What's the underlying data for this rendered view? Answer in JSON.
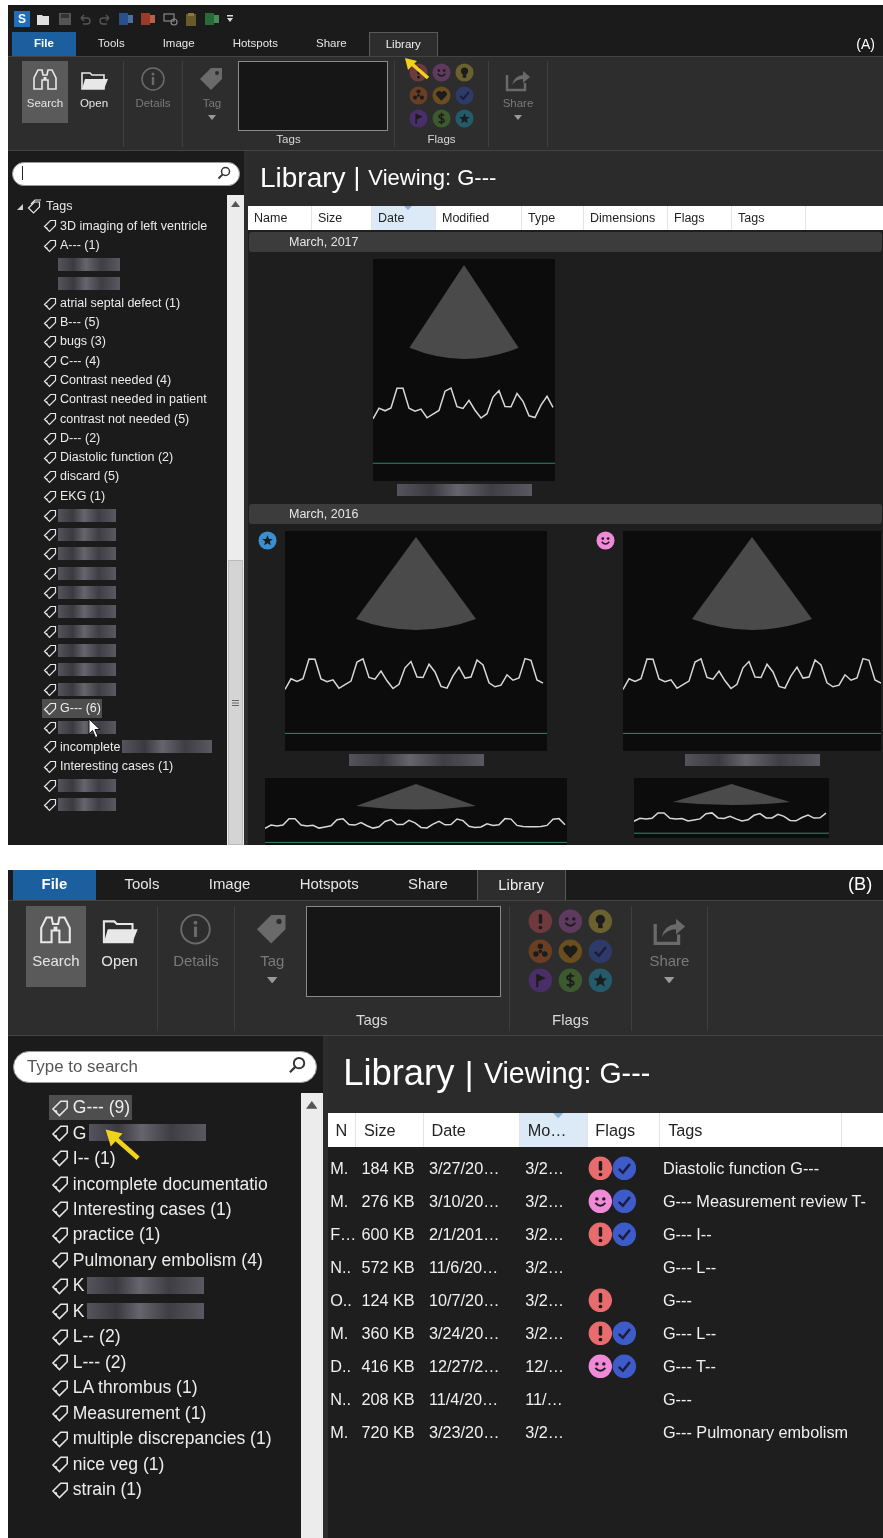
{
  "panels": [
    {
      "label": "(A)",
      "logo": "S",
      "tabs": [
        {
          "label": "File",
          "kind": "file",
          "selected": false
        },
        {
          "label": "Tools",
          "kind": "tab",
          "selected": false
        },
        {
          "label": "Image",
          "kind": "tab",
          "selected": false
        },
        {
          "label": "Hotspots",
          "kind": "tab",
          "selected": false
        },
        {
          "label": "Share",
          "kind": "tab",
          "selected": false
        },
        {
          "label": "Library",
          "kind": "tab",
          "selected": true
        }
      ],
      "ribbon": [
        {
          "kind": "buttons",
          "buttons": [
            {
              "label": "Search",
              "kind": "search",
              "selected": true,
              "disabled": false
            },
            {
              "label": "Open",
              "kind": "open",
              "selected": false,
              "disabled": false
            }
          ]
        },
        {
          "kind": "buttons",
          "buttons": [
            {
              "label": "Details",
              "kind": "details",
              "selected": false,
              "disabled": true
            }
          ]
        },
        {
          "kind": "tag_box",
          "label": "Tags",
          "buttons": [
            {
              "label": "Tag",
              "kind": "tag",
              "selected": false,
              "disabled": true
            }
          ]
        },
        {
          "kind": "flags",
          "label": "Flags",
          "flags": [
            {
              "kind": "alert",
              "color": "#6e3a3e"
            },
            {
              "kind": "smile",
              "color": "#5e3a5e"
            },
            {
              "kind": "bulb",
              "color": "#6a6030"
            },
            {
              "kind": "radiation",
              "color": "#6a3e22"
            },
            {
              "kind": "heart",
              "color": "#6a4e20"
            },
            {
              "kind": "check",
              "color": "#2e3a68"
            },
            {
              "kind": "flag",
              "color": "#4a2e6a"
            },
            {
              "kind": "dollar",
              "color": "#3c5a2e"
            },
            {
              "kind": "star",
              "color": "#245a6a"
            }
          ]
        },
        {
          "kind": "buttons",
          "buttons": [
            {
              "label": "Share",
              "kind": "share",
              "selected": false,
              "disabled": true
            }
          ]
        }
      ],
      "search": {
        "focused": true
      },
      "tree": {
        "root": {
          "label": "Tags",
          "expanded": true
        },
        "items": [
          {
            "kind": "tag",
            "label": "3D imaging of left ventricle",
            "redacted": false,
            "selected": false
          },
          {
            "kind": "tag",
            "label": "A--- (1)",
            "redacted": false,
            "selected": false
          },
          {
            "kind": "blurred",
            "redacted": true,
            "selected": false
          },
          {
            "kind": "blurred",
            "redacted": true,
            "selected": false
          },
          {
            "kind": "tag",
            "label": "atrial septal defect (1)",
            "redacted": false,
            "selected": false
          },
          {
            "kind": "tag",
            "label": "B--- (5)",
            "redacted": false,
            "selected": false
          },
          {
            "kind": "tag",
            "label": "bugs (3)",
            "redacted": false,
            "selected": false
          },
          {
            "kind": "tag",
            "label": "C--- (4)",
            "redacted": false,
            "selected": false
          },
          {
            "kind": "tag",
            "label": "Contrast needed (4)",
            "redacted": false,
            "selected": false
          },
          {
            "kind": "tag",
            "label": "Contrast needed in patient",
            "redacted": false,
            "selected": false
          },
          {
            "kind": "tag",
            "label": "contrast not needed (5)",
            "redacted": false,
            "selected": false
          },
          {
            "kind": "tag",
            "label": "D--- (2)",
            "redacted": false,
            "selected": false
          },
          {
            "kind": "tag",
            "label": "Diastolic function (2)",
            "redacted": false,
            "selected": false
          },
          {
            "kind": "tag",
            "label": "discard (5)",
            "redacted": false,
            "selected": false
          },
          {
            "kind": "tag",
            "label": "EKG (1)",
            "redacted": false,
            "selected": false
          },
          {
            "kind": "tag",
            "redacted": true,
            "selected": false
          },
          {
            "kind": "tag",
            "redacted": true,
            "selected": false
          },
          {
            "kind": "tag",
            "redacted": true,
            "selected": false
          },
          {
            "kind": "tag",
            "redacted": true,
            "selected": false
          },
          {
            "kind": "tag",
            "redacted": true,
            "selected": false
          },
          {
            "kind": "tag",
            "redacted": true,
            "selected": false
          },
          {
            "kind": "tag",
            "redacted": true,
            "selected": false
          },
          {
            "kind": "tag",
            "redacted": true,
            "selected": false
          },
          {
            "kind": "tag",
            "redacted": true,
            "selected": false
          },
          {
            "kind": "tag",
            "redacted": true,
            "selected": false
          },
          {
            "kind": "tag",
            "label": "G--- (6)",
            "redacted": false,
            "selected": true
          },
          {
            "kind": "tag",
            "redacted": true,
            "selected": false
          },
          {
            "kind": "tag",
            "label": "incomplete",
            "redacted": true,
            "selected": false
          },
          {
            "kind": "tag",
            "label": "Interesting cases (1)",
            "redacted": false,
            "selected": false
          },
          {
            "kind": "tag",
            "redacted": true,
            "selected": false
          },
          {
            "kind": "tag",
            "redacted": true,
            "selected": false
          }
        ]
      },
      "view": {
        "title": "Library",
        "separator": "|",
        "subtitle": "Viewing: G---",
        "columns": [
          {
            "label": "Name",
            "selected": false
          },
          {
            "label": "Size",
            "selected": false
          },
          {
            "label": "Date",
            "selected": true
          },
          {
            "label": "Modified",
            "selected": false
          },
          {
            "label": "Type",
            "selected": false
          },
          {
            "label": "Dimensions",
            "selected": false
          },
          {
            "label": "Flags",
            "selected": false
          },
          {
            "label": "Tags",
            "selected": false
          }
        ],
        "groups": [
          {
            "label": "March, 2017",
            "items": [
              {
                "kind": "none",
                "caption_redacted": true
              }
            ]
          },
          {
            "label": "March, 2016",
            "items": [
              {
                "kind": "star",
                "caption_redacted": true
              },
              {
                "kind": "smile",
                "caption_redacted": true
              },
              {
                "kind": "none",
                "caption_redacted": false
              },
              {
                "kind": "none",
                "caption_redacted": false
              }
            ]
          }
        ]
      }
    },
    {
      "label": "(B)",
      "tabs": [
        {
          "label": "File",
          "kind": "file",
          "selected": false
        },
        {
          "label": "Tools",
          "kind": "tab",
          "selected": false
        },
        {
          "label": "Image",
          "kind": "tab",
          "selected": false
        },
        {
          "label": "Hotspots",
          "kind": "tab",
          "selected": false
        },
        {
          "label": "Share",
          "kind": "tab",
          "selected": false
        },
        {
          "label": "Library",
          "kind": "tab",
          "selected": true
        }
      ],
      "ribbon": [
        {
          "kind": "buttons",
          "buttons": [
            {
              "label": "Search",
              "kind": "search",
              "selected": true,
              "disabled": false
            },
            {
              "label": "Open",
              "kind": "open",
              "selected": false,
              "disabled": false
            }
          ]
        },
        {
          "kind": "buttons",
          "buttons": [
            {
              "label": "Details",
              "kind": "details",
              "selected": false,
              "disabled": true
            }
          ]
        },
        {
          "kind": "tag_box",
          "label": "Tags",
          "buttons": [
            {
              "label": "Tag",
              "kind": "tag",
              "selected": false,
              "disabled": true
            }
          ]
        },
        {
          "kind": "flags",
          "label": "Flags",
          "flags": [
            {
              "kind": "alert",
              "color": "#6e3a3e"
            },
            {
              "kind": "smile",
              "color": "#5e3a5e"
            },
            {
              "kind": "bulb",
              "color": "#6a6030"
            },
            {
              "kind": "radiation",
              "color": "#6a3e22"
            },
            {
              "kind": "heart",
              "color": "#6a4e20"
            },
            {
              "kind": "check",
              "color": "#2e3a68"
            },
            {
              "kind": "flag",
              "color": "#4a2e6a"
            },
            {
              "kind": "dollar",
              "color": "#3c5a2e"
            },
            {
              "kind": "star",
              "color": "#245a6a"
            }
          ]
        },
        {
          "kind": "buttons",
          "buttons": [
            {
              "label": "Share",
              "kind": "share",
              "selected": false,
              "disabled": true
            }
          ]
        }
      ],
      "search": {
        "placeholder": "Type to search",
        "focused": false
      },
      "tree": {
        "items": [
          {
            "kind": "tag",
            "label": "G--- (9)",
            "redacted": false,
            "selected": true
          },
          {
            "kind": "tag",
            "label": "G",
            "redacted": true,
            "selected": false
          },
          {
            "kind": "tag",
            "label": "I-- (1)",
            "redacted": false,
            "selected": false
          },
          {
            "kind": "tag",
            "label": "incomplete documentatio",
            "redacted": false,
            "selected": false
          },
          {
            "kind": "tag",
            "label": "Interesting cases (1)",
            "redacted": false,
            "selected": false
          },
          {
            "kind": "tag",
            "label": "practice (1)",
            "redacted": false,
            "selected": false
          },
          {
            "kind": "tag",
            "label": "Pulmonary embolism (4)",
            "redacted": false,
            "selected": false
          },
          {
            "kind": "tag",
            "label": "K",
            "redacted": true,
            "selected": false
          },
          {
            "kind": "tag",
            "label": "K",
            "redacted": true,
            "selected": false
          },
          {
            "kind": "tag",
            "label": "L-- (2)",
            "redacted": false,
            "selected": false
          },
          {
            "kind": "tag",
            "label": "L--- (2)",
            "redacted": false,
            "selected": false
          },
          {
            "kind": "tag",
            "label": "LA thrombus (1)",
            "redacted": false,
            "selected": false
          },
          {
            "kind": "tag",
            "label": "Measurement (1)",
            "redacted": false,
            "selected": false
          },
          {
            "kind": "tag",
            "label": "multiple discrepancies (1)",
            "redacted": false,
            "selected": false
          },
          {
            "kind": "tag",
            "label": "nice veg (1)",
            "redacted": false,
            "selected": false
          },
          {
            "kind": "tag",
            "label": "strain (1)",
            "redacted": false,
            "selected": false
          }
        ]
      },
      "view": {
        "title": "Library",
        "separator": "|",
        "subtitle": "Viewing: G---",
        "columns": [
          {
            "label": "N",
            "selected": false
          },
          {
            "label": "Size",
            "selected": false
          },
          {
            "label": "Date",
            "selected": false
          },
          {
            "label": "Mo…",
            "selected": true
          },
          {
            "label": "Flags",
            "selected": false
          },
          {
            "label": "Tags",
            "selected": false
          }
        ],
        "rows": [
          {
            "name": "M.",
            "size": "184 KB",
            "date": "3/27/20…",
            "modified": "3/2…",
            "flags": [
              {
                "kind": "alert"
              },
              {
                "kind": "check"
              }
            ],
            "tags": "Diastolic function G---"
          },
          {
            "name": "M.",
            "size": "276 KB",
            "date": "3/10/20…",
            "modified": "3/2…",
            "flags": [
              {
                "kind": "smile"
              },
              {
                "kind": "check"
              }
            ],
            "tags": "G--- Measurement review T-"
          },
          {
            "name": "F…",
            "size": "600 KB",
            "date": "2/1/201…",
            "modified": "3/2…",
            "flags": [
              {
                "kind": "alert"
              },
              {
                "kind": "check"
              }
            ],
            "tags": "G--- I--"
          },
          {
            "name": "N..",
            "size": "572 KB",
            "date": "11/6/20…",
            "modified": "3/2…",
            "flags": [],
            "tags": "G--- L--"
          },
          {
            "name": "O..",
            "size": "124 KB",
            "date": "10/7/20…",
            "modified": "3/2…",
            "flags": [
              {
                "kind": "alert"
              }
            ],
            "tags": "G---"
          },
          {
            "name": "M.",
            "size": "360 KB",
            "date": "3/24/20…",
            "modified": "3/2…",
            "flags": [
              {
                "kind": "alert"
              },
              {
                "kind": "check"
              }
            ],
            "tags": "G--- L--"
          },
          {
            "name": "D..",
            "size": "416 KB",
            "date": "12/27/2…",
            "modified": "12/…",
            "flags": [
              {
                "kind": "smile"
              },
              {
                "kind": "check"
              }
            ],
            "tags": "G--- T--"
          },
          {
            "name": "N..",
            "size": "208 KB",
            "date": "11/4/20…",
            "modified": "11/…",
            "flags": [],
            "tags": "G---"
          },
          {
            "name": "M.",
            "size": "720 KB",
            "date": "3/23/20…",
            "modified": "3/2…",
            "flags": [],
            "tags": "G--- Pulmonary embolism"
          }
        ]
      }
    }
  ]
}
